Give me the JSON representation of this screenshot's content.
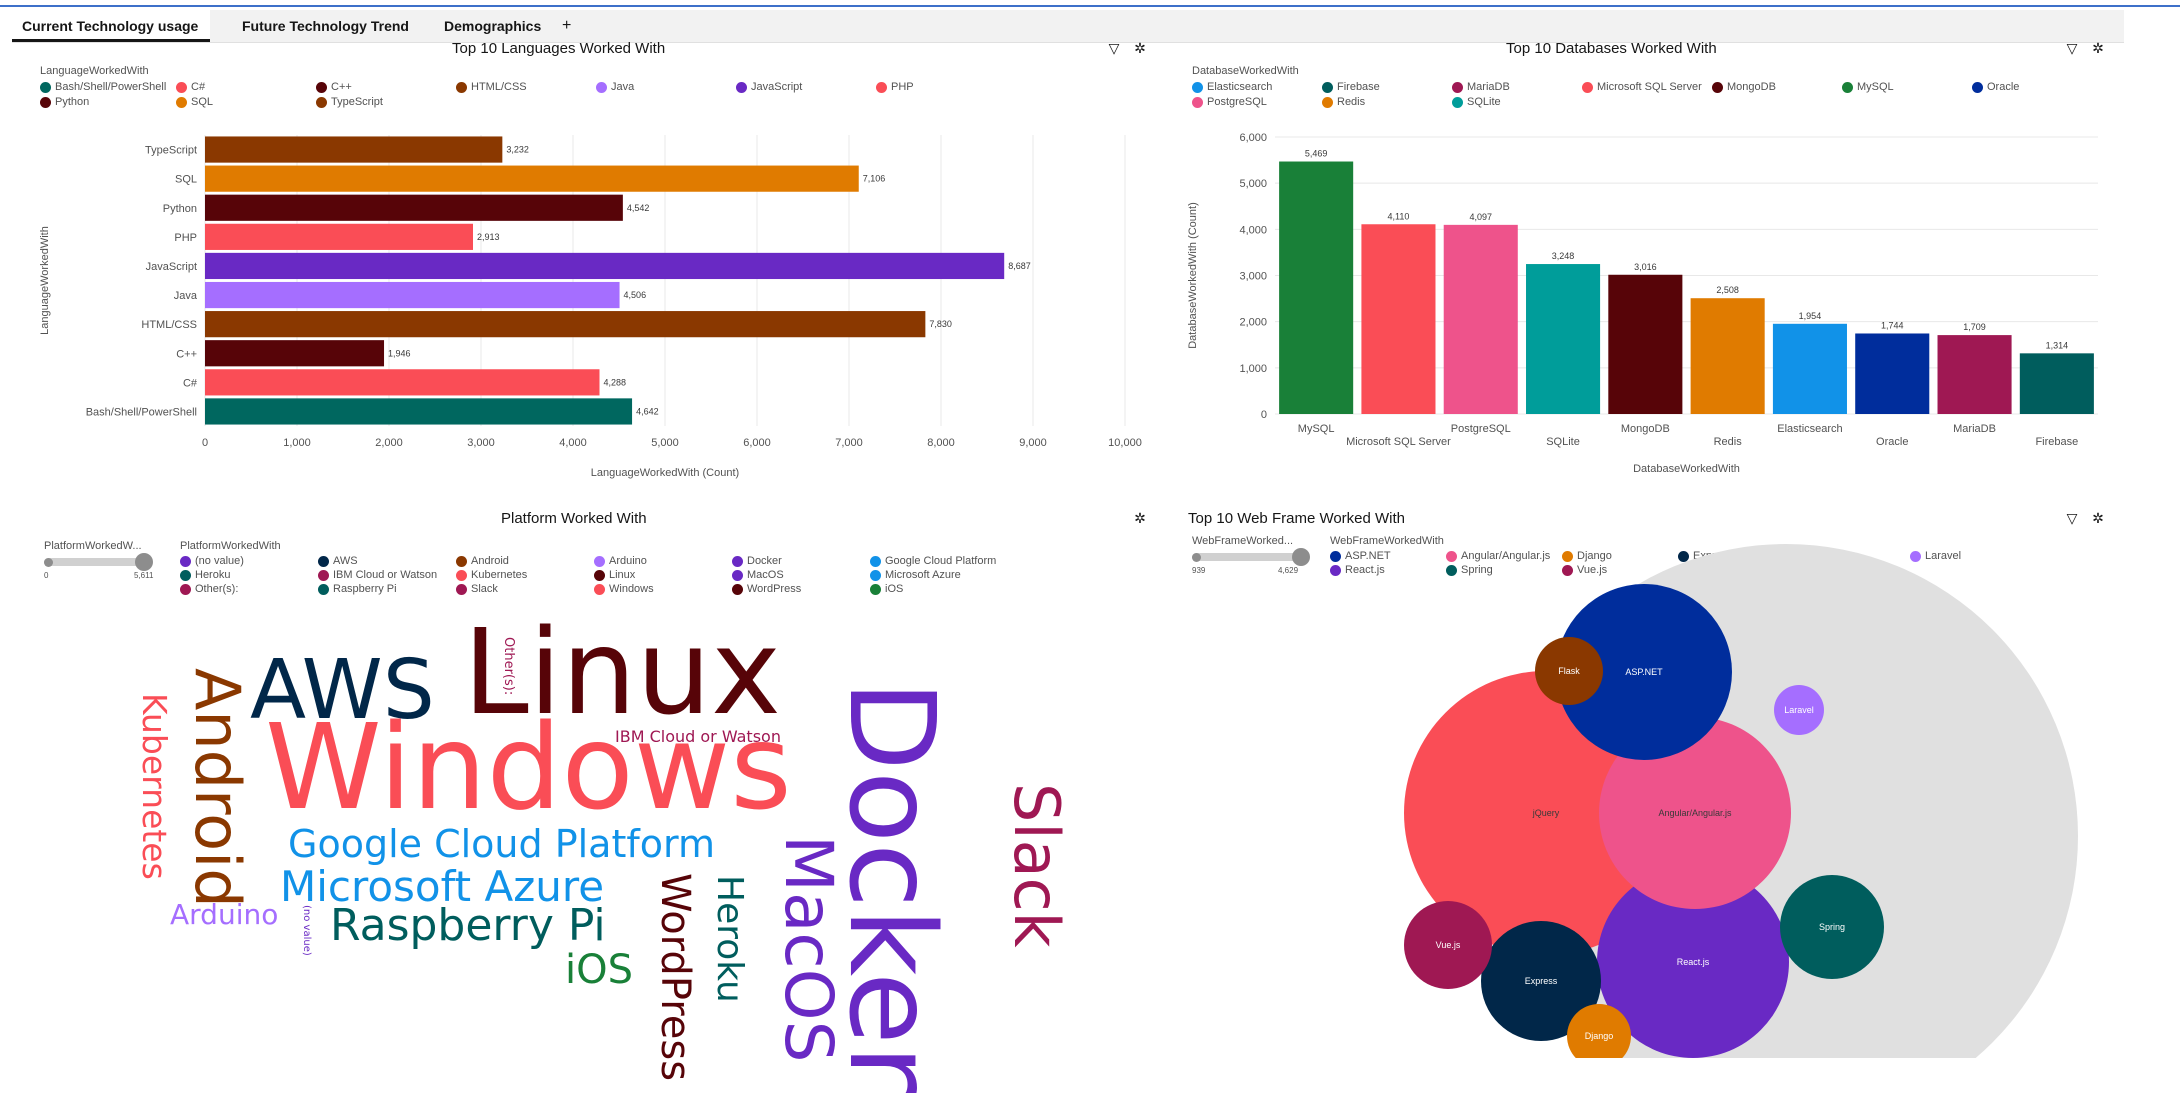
{
  "tabs": [
    {
      "label": "Current Technology usage",
      "active": true
    },
    {
      "label": "Future Technology Trend",
      "active": false
    },
    {
      "label": "Demographics",
      "active": false
    }
  ],
  "add_tab_label": "+",
  "languages_panel": {
    "title": "Top 10 Languages Worked With",
    "legend_title": "LanguageWorkedWith",
    "legend": [
      {
        "label": "Bash/Shell/PowerShell",
        "color": "#00675f"
      },
      {
        "label": "C#",
        "color": "#fa4d56"
      },
      {
        "label": "C++",
        "color": "#570408"
      },
      {
        "label": "HTML/CSS",
        "color": "#8a3800"
      },
      {
        "label": "Java",
        "color": "#a56eff"
      },
      {
        "label": "JavaScript",
        "color": "#6929c4"
      },
      {
        "label": "PHP",
        "color": "#fa4d56"
      },
      {
        "label": "Python",
        "color": "#570408"
      },
      {
        "label": "SQL",
        "color": "#e07b00"
      },
      {
        "label": "TypeScript",
        "color": "#8a3800"
      }
    ]
  },
  "databases_panel": {
    "title": "Top 10 Databases Worked With",
    "legend_title": "DatabaseWorkedWith",
    "legend": [
      {
        "label": "Elasticsearch",
        "color": "#1192e8"
      },
      {
        "label": "Firebase",
        "color": "#005d5d"
      },
      {
        "label": "MariaDB",
        "color": "#9f1853"
      },
      {
        "label": "Microsoft SQL Server",
        "color": "#fa4d56"
      },
      {
        "label": "MongoDB",
        "color": "#570408"
      },
      {
        "label": "MySQL",
        "color": "#198038"
      },
      {
        "label": "Oracle",
        "color": "#002d9c"
      },
      {
        "label": "PostgreSQL",
        "color": "#ee538b"
      },
      {
        "label": "Redis",
        "color": "#e07b00"
      },
      {
        "label": "SQLite",
        "color": "#009d9a"
      }
    ]
  },
  "platform_panel": {
    "title": "Platform Worked With",
    "slider_label": "PlatformWorkedW...",
    "slider_min": "0",
    "slider_max": "5,611",
    "legend_title": "PlatformWorkedWith",
    "legend": [
      {
        "label": "(no value)",
        "color": "#6929c4"
      },
      {
        "label": "AWS",
        "color": "#012749"
      },
      {
        "label": "Android",
        "color": "#8a3800"
      },
      {
        "label": "Arduino",
        "color": "#a56eff"
      },
      {
        "label": "Docker",
        "color": "#6929c4"
      },
      {
        "label": "Google Cloud Platform",
        "color": "#1192e8"
      },
      {
        "label": "Heroku",
        "color": "#005d5d"
      },
      {
        "label": "IBM Cloud or Watson",
        "color": "#9f1853"
      },
      {
        "label": "Kubernetes",
        "color": "#fa4d56"
      },
      {
        "label": "Linux",
        "color": "#570408"
      },
      {
        "label": "MacOS",
        "color": "#6929c4"
      },
      {
        "label": "Microsoft Azure",
        "color": "#1192e8"
      },
      {
        "label": "Other(s):",
        "color": "#9f1853"
      },
      {
        "label": "Raspberry Pi",
        "color": "#005d5d"
      },
      {
        "label": "Slack",
        "color": "#9f1853"
      },
      {
        "label": "Windows",
        "color": "#fa4d56"
      },
      {
        "label": "WordPress",
        "color": "#570408"
      },
      {
        "label": "iOS",
        "color": "#198038"
      }
    ],
    "words": {
      "linux": "Linux",
      "aws": "AWS",
      "windows": "Windows",
      "docker": "Docker",
      "android": "Android",
      "kubernetes": "Kubernetes",
      "others": "Other(s):",
      "ibm": "IBM Cloud or Watson",
      "gcp": "Google Cloud Platform",
      "azure": "Microsoft Azure",
      "arduino": "Arduino",
      "novalue": "(no value)",
      "raspberry": "Raspberry Pi",
      "ios": "iOS",
      "wordpress": "WordPress",
      "heroku": "Heroku",
      "macos": "MacOS",
      "slack": "Slack"
    }
  },
  "webframe_panel": {
    "title": "Top 10  Web Frame Worked With",
    "slider_label": "WebFrameWorked...",
    "slider_min": "939",
    "slider_max": "4,629",
    "legend_title": "WebFrameWorkedWith",
    "legend": [
      {
        "label": "ASP.NET",
        "color": "#002d9c"
      },
      {
        "label": "Angular/Angular.js",
        "color": "#ee538b"
      },
      {
        "label": "Django",
        "color": "#e07b00"
      },
      {
        "label": "Express",
        "color": "#012749"
      },
      {
        "label": "Flask",
        "color": "#8a3800"
      },
      {
        "label": "Laravel",
        "color": "#a56eff"
      },
      {
        "label": "React.js",
        "color": "#6929c4"
      },
      {
        "label": "Spring",
        "color": "#005d5d"
      },
      {
        "label": "Vue.js",
        "color": "#9f1853"
      },
      {
        "label": "jQuery",
        "color": "#fa4d56"
      }
    ]
  },
  "chart_data": [
    {
      "type": "bar",
      "orientation": "horizontal",
      "title": "Top 10 Languages Worked With",
      "xlabel": "LanguageWorkedWith (Count)",
      "ylabel": "LanguageWorkedWith",
      "xlim": [
        0,
        10000
      ],
      "xticks": [
        "0",
        "1,000",
        "2,000",
        "3,000",
        "4,000",
        "5,000",
        "6,000",
        "7,000",
        "8,000",
        "9,000",
        "10,000"
      ],
      "categories": [
        "TypeScript",
        "SQL",
        "Python",
        "PHP",
        "JavaScript",
        "Java",
        "HTML/CSS",
        "C++",
        "C#",
        "Bash/Shell/PowerShell"
      ],
      "values": [
        3232,
        7106,
        4542,
        2913,
        8687,
        4506,
        7830,
        1946,
        4288,
        4642
      ],
      "value_labels": [
        "3,232",
        "7,106",
        "4,542",
        "2,913",
        "8,687",
        "4,506",
        "7,830",
        "1,946",
        "4,288",
        "4,642"
      ],
      "colors": [
        "#8a3800",
        "#e07b00",
        "#570408",
        "#fa4d56",
        "#6929c4",
        "#a56eff",
        "#8a3800",
        "#570408",
        "#fa4d56",
        "#00675f"
      ],
      "legend": "top",
      "grid": true
    },
    {
      "type": "bar",
      "orientation": "vertical",
      "title": "Top 10 Databases Worked With",
      "xlabel": "DatabaseWorkedWith",
      "ylabel": "DatabaseWorkedWith (Count)",
      "ylim": [
        0,
        6000
      ],
      "yticks": [
        "0",
        "1,000",
        "2,000",
        "3,000",
        "4,000",
        "5,000",
        "6,000"
      ],
      "categories": [
        "MySQL",
        "Microsoft SQL Server",
        "PostgreSQL",
        "SQLite",
        "MongoDB",
        "Redis",
        "Elasticsearch",
        "Oracle",
        "MariaDB",
        "Firebase"
      ],
      "values": [
        5469,
        4110,
        4097,
        3248,
        3016,
        2508,
        1954,
        1744,
        1709,
        1314
      ],
      "value_labels": [
        "5,469",
        "4,110",
        "4,097",
        "3,248",
        "3,016",
        "2,508",
        "1,954",
        "1,744",
        "1,709",
        "1,314"
      ],
      "colors": [
        "#198038",
        "#fa4d56",
        "#ee538b",
        "#009d9a",
        "#570408",
        "#e07b00",
        "#1192e8",
        "#002d9c",
        "#9f1853",
        "#005d5d"
      ],
      "legend": "top",
      "grid": true
    },
    {
      "type": "bubble",
      "title": "Top 10  Web Frame Worked With",
      "categories": [
        "jQuery",
        "React.js",
        "Angular/Angular.js",
        "ASP.NET",
        "Express",
        "Spring",
        "Vue.js",
        "Flask",
        "Django",
        "Laravel"
      ],
      "values": [
        4629,
        3700,
        3000,
        2900,
        1800,
        1300,
        1050,
        1000,
        950,
        939
      ],
      "colors": [
        "#fa4d56",
        "#6929c4",
        "#ee538b",
        "#002d9c",
        "#012749",
        "#005d5d",
        "#9f1853",
        "#8a3800",
        "#e07b00",
        "#a56eff"
      ],
      "legend": "top"
    }
  ]
}
